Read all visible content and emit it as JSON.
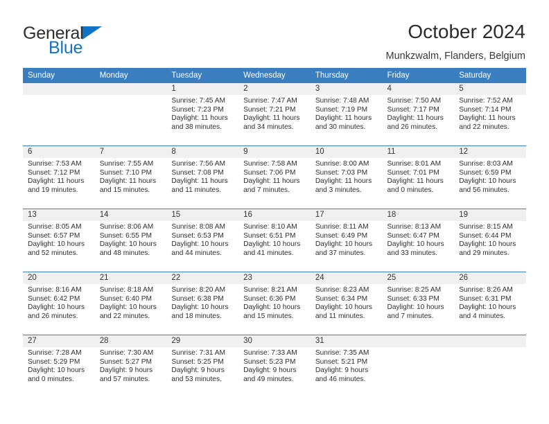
{
  "logo": {
    "word1": "General",
    "word2": "Blue",
    "triangle_color": "#1273c4"
  },
  "header": {
    "title": "October 2024",
    "subtitle": "Munkzwalm, Flanders, Belgium"
  },
  "theme": {
    "header_blue": "#3a7ebf",
    "daynum_band": "#f0f0f0",
    "text": "#2e2e2e"
  },
  "weekday_headers": [
    "Sunday",
    "Monday",
    "Tuesday",
    "Wednesday",
    "Thursday",
    "Friday",
    "Saturday"
  ],
  "labels": {
    "sunrise_prefix": "Sunrise: ",
    "sunset_prefix": "Sunset: ",
    "daylight_prefix": "Daylight: "
  },
  "weeks": [
    [
      {
        "day": "",
        "blank": true
      },
      {
        "day": "",
        "blank": true
      },
      {
        "day": "1",
        "sunrise": "Sunrise: 7:45 AM",
        "sunset": "Sunset: 7:23 PM",
        "daylight": "Daylight: 11 hours and 38 minutes."
      },
      {
        "day": "2",
        "sunrise": "Sunrise: 7:47 AM",
        "sunset": "Sunset: 7:21 PM",
        "daylight": "Daylight: 11 hours and 34 minutes."
      },
      {
        "day": "3",
        "sunrise": "Sunrise: 7:48 AM",
        "sunset": "Sunset: 7:19 PM",
        "daylight": "Daylight: 11 hours and 30 minutes."
      },
      {
        "day": "4",
        "sunrise": "Sunrise: 7:50 AM",
        "sunset": "Sunset: 7:17 PM",
        "daylight": "Daylight: 11 hours and 26 minutes."
      },
      {
        "day": "5",
        "sunrise": "Sunrise: 7:52 AM",
        "sunset": "Sunset: 7:14 PM",
        "daylight": "Daylight: 11 hours and 22 minutes."
      }
    ],
    [
      {
        "day": "6",
        "sunrise": "Sunrise: 7:53 AM",
        "sunset": "Sunset: 7:12 PM",
        "daylight": "Daylight: 11 hours and 19 minutes."
      },
      {
        "day": "7",
        "sunrise": "Sunrise: 7:55 AM",
        "sunset": "Sunset: 7:10 PM",
        "daylight": "Daylight: 11 hours and 15 minutes."
      },
      {
        "day": "8",
        "sunrise": "Sunrise: 7:56 AM",
        "sunset": "Sunset: 7:08 PM",
        "daylight": "Daylight: 11 hours and 11 minutes."
      },
      {
        "day": "9",
        "sunrise": "Sunrise: 7:58 AM",
        "sunset": "Sunset: 7:06 PM",
        "daylight": "Daylight: 11 hours and 7 minutes."
      },
      {
        "day": "10",
        "sunrise": "Sunrise: 8:00 AM",
        "sunset": "Sunset: 7:03 PM",
        "daylight": "Daylight: 11 hours and 3 minutes."
      },
      {
        "day": "11",
        "sunrise": "Sunrise: 8:01 AM",
        "sunset": "Sunset: 7:01 PM",
        "daylight": "Daylight: 11 hours and 0 minutes."
      },
      {
        "day": "12",
        "sunrise": "Sunrise: 8:03 AM",
        "sunset": "Sunset: 6:59 PM",
        "daylight": "Daylight: 10 hours and 56 minutes."
      }
    ],
    [
      {
        "day": "13",
        "sunrise": "Sunrise: 8:05 AM",
        "sunset": "Sunset: 6:57 PM",
        "daylight": "Daylight: 10 hours and 52 minutes."
      },
      {
        "day": "14",
        "sunrise": "Sunrise: 8:06 AM",
        "sunset": "Sunset: 6:55 PM",
        "daylight": "Daylight: 10 hours and 48 minutes."
      },
      {
        "day": "15",
        "sunrise": "Sunrise: 8:08 AM",
        "sunset": "Sunset: 6:53 PM",
        "daylight": "Daylight: 10 hours and 44 minutes."
      },
      {
        "day": "16",
        "sunrise": "Sunrise: 8:10 AM",
        "sunset": "Sunset: 6:51 PM",
        "daylight": "Daylight: 10 hours and 41 minutes."
      },
      {
        "day": "17",
        "sunrise": "Sunrise: 8:11 AM",
        "sunset": "Sunset: 6:49 PM",
        "daylight": "Daylight: 10 hours and 37 minutes."
      },
      {
        "day": "18",
        "sunrise": "Sunrise: 8:13 AM",
        "sunset": "Sunset: 6:47 PM",
        "daylight": "Daylight: 10 hours and 33 minutes."
      },
      {
        "day": "19",
        "sunrise": "Sunrise: 8:15 AM",
        "sunset": "Sunset: 6:44 PM",
        "daylight": "Daylight: 10 hours and 29 minutes."
      }
    ],
    [
      {
        "day": "20",
        "sunrise": "Sunrise: 8:16 AM",
        "sunset": "Sunset: 6:42 PM",
        "daylight": "Daylight: 10 hours and 26 minutes."
      },
      {
        "day": "21",
        "sunrise": "Sunrise: 8:18 AM",
        "sunset": "Sunset: 6:40 PM",
        "daylight": "Daylight: 10 hours and 22 minutes."
      },
      {
        "day": "22",
        "sunrise": "Sunrise: 8:20 AM",
        "sunset": "Sunset: 6:38 PM",
        "daylight": "Daylight: 10 hours and 18 minutes."
      },
      {
        "day": "23",
        "sunrise": "Sunrise: 8:21 AM",
        "sunset": "Sunset: 6:36 PM",
        "daylight": "Daylight: 10 hours and 15 minutes."
      },
      {
        "day": "24",
        "sunrise": "Sunrise: 8:23 AM",
        "sunset": "Sunset: 6:34 PM",
        "daylight": "Daylight: 10 hours and 11 minutes."
      },
      {
        "day": "25",
        "sunrise": "Sunrise: 8:25 AM",
        "sunset": "Sunset: 6:33 PM",
        "daylight": "Daylight: 10 hours and 7 minutes."
      },
      {
        "day": "26",
        "sunrise": "Sunrise: 8:26 AM",
        "sunset": "Sunset: 6:31 PM",
        "daylight": "Daylight: 10 hours and 4 minutes."
      }
    ],
    [
      {
        "day": "27",
        "sunrise": "Sunrise: 7:28 AM",
        "sunset": "Sunset: 5:29 PM",
        "daylight": "Daylight: 10 hours and 0 minutes."
      },
      {
        "day": "28",
        "sunrise": "Sunrise: 7:30 AM",
        "sunset": "Sunset: 5:27 PM",
        "daylight": "Daylight: 9 hours and 57 minutes."
      },
      {
        "day": "29",
        "sunrise": "Sunrise: 7:31 AM",
        "sunset": "Sunset: 5:25 PM",
        "daylight": "Daylight: 9 hours and 53 minutes."
      },
      {
        "day": "30",
        "sunrise": "Sunrise: 7:33 AM",
        "sunset": "Sunset: 5:23 PM",
        "daylight": "Daylight: 9 hours and 49 minutes."
      },
      {
        "day": "31",
        "sunrise": "Sunrise: 7:35 AM",
        "sunset": "Sunset: 5:21 PM",
        "daylight": "Daylight: 9 hours and 46 minutes."
      },
      {
        "day": "",
        "blank": true
      },
      {
        "day": "",
        "blank": true
      }
    ]
  ]
}
